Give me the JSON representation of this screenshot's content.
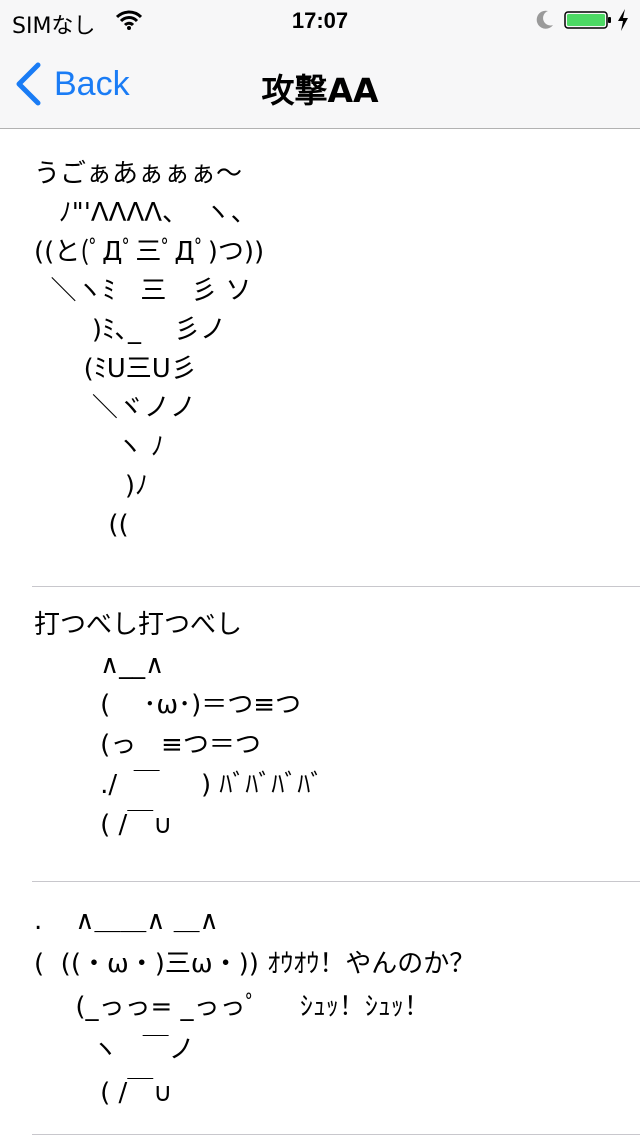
{
  "status_bar": {
    "carrier": "SIMなし",
    "time": "17:07"
  },
  "nav": {
    "back_label": "Back",
    "title": "攻撃AA"
  },
  "colors": {
    "accent": "#1a7cf5",
    "battery": "#4cd964",
    "separator": "#c8c7cc"
  },
  "items": [
    {
      "text": "うごぁあぁぁぁ〜\n   ﾉ\"'ΛΛΛΛ、  ヽ、\n((と(ﾟДﾟ三ﾟДﾟ)つ))\n  ＼ヽﾐ   三   彡 ソ\n       )ﾐ､_    彡ノ\n      (ﾐU三U彡\n       ＼ヾノノ\n          ヽ ﾉ\n           )ﾉ\n         (("
    },
    {
      "text": "打つべし打つべし\n        ∧__∧\n        (    ･ω･)＝つ≡つ\n        (っ   ≡つ＝つ\n        ./  ￣     ) ﾊﾞﾊﾞﾊﾞﾊﾞ\n        ( /￣∪"
    },
    {
      "text": ".    ∧＿＿∧ ＿∧\n(  ((・ω・)三ω・)) ｵｳｵｳ！やんのか？\n     (_っっ= _っっﾟ     ｼｭｯ！ｼｭｯ！\n       ヽ   ￣ノ\n        ( /￣∪"
    }
  ]
}
